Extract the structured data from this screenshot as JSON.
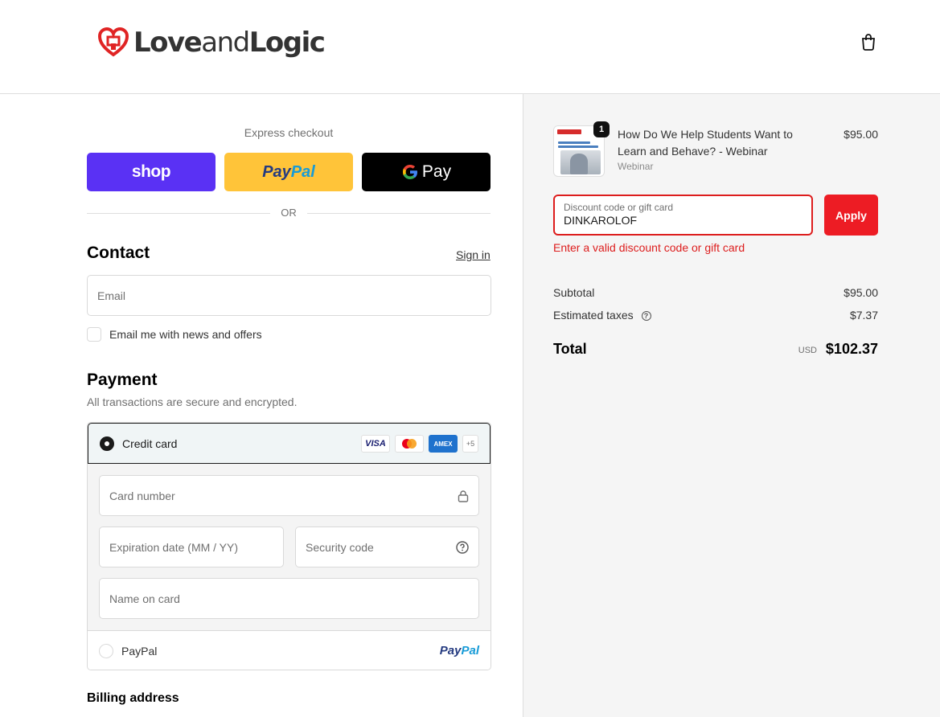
{
  "brand": {
    "logo_word1": "Love",
    "logo_word2": "and",
    "logo_word3": "Logic"
  },
  "express": {
    "label": "Express checkout",
    "shop_label": "shop",
    "paypal_label_1": "Pay",
    "paypal_label_2": "Pal",
    "gpay_label": "Pay",
    "or_label": "OR"
  },
  "contact": {
    "heading": "Contact",
    "sign_in": "Sign in",
    "email_placeholder": "Email",
    "news_label": "Email me with news and offers"
  },
  "payment": {
    "heading": "Payment",
    "subtitle": "All transactions are secure and encrypted.",
    "credit_card_label": "Credit card",
    "brands": {
      "visa": "VISA",
      "amex": "AMEX",
      "more": "+5"
    },
    "card_number_placeholder": "Card number",
    "expiry_placeholder": "Expiration date (MM / YY)",
    "security_placeholder": "Security code",
    "name_placeholder": "Name on card",
    "paypal_label": "PayPal",
    "paypal_logo_1": "Pay",
    "paypal_logo_2": "Pal"
  },
  "billing": {
    "heading": "Billing address"
  },
  "order": {
    "item": {
      "quantity": "1",
      "title": "How Do We Help Students Want to Learn and Behave? - Webinar",
      "subtitle": "Webinar",
      "price": "$95.00"
    },
    "discount": {
      "label": "Discount code or gift card",
      "value": "DINKAROLOF",
      "apply_label": "Apply",
      "error": "Enter a valid discount code or gift card"
    },
    "subtotal_label": "Subtotal",
    "subtotal_value": "$95.00",
    "taxes_label": "Estimated taxes",
    "taxes_value": "$7.37",
    "total_label": "Total",
    "total_currency": "USD",
    "total_value": "$102.37"
  },
  "colors": {
    "accent": "#ed1c24",
    "shop": "#5a31f4",
    "paypal": "#ffc439",
    "error": "#dd1d1d"
  }
}
